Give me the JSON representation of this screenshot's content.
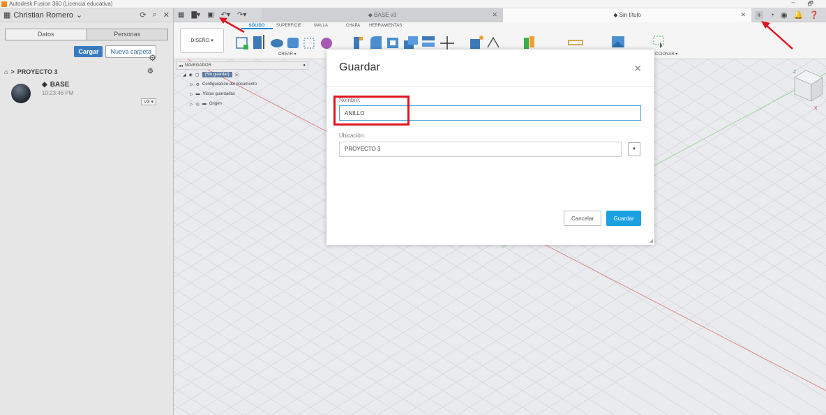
{
  "window": {
    "title": "Autodesk Fusion 360 (Licencia educativa)",
    "min": "–",
    "max": "🗗"
  },
  "data_panel": {
    "user": "Christian Romero",
    "tabs": [
      "Datos",
      "Personas"
    ],
    "upload_label": "Cargar",
    "new_folder_label": "Nueva carpeta",
    "project": "PROYECTO 3",
    "file": {
      "name": "BASE",
      "time": "10:23:46 PM",
      "version": "V3 ▾"
    }
  },
  "tabs": {
    "inactive": "BASE v3",
    "active": "Sin título"
  },
  "toolbar": {
    "design_label": "DISEÑO ▾",
    "workspace_tabs": [
      "SÓLIDO",
      "SUPERFICIE",
      "MALLA",
      "CHAPA",
      "HERRAMIENTAS"
    ],
    "create_label": "CREAR ▾",
    "select_label": "ECCIONAR ▾"
  },
  "navigator": {
    "title": "NAVEGADOR",
    "root": "(Sin guardar)",
    "items": [
      "Configuración del documento",
      "Vistas guardadas",
      "Origen"
    ]
  },
  "dialog": {
    "title": "Guardar",
    "name_label": "Nombre:",
    "name_value": "ANILLO",
    "location_label": "Ubicación:",
    "location_value": "PROYECTO 3",
    "cancel_label": "Cancelar",
    "save_label": "Guardar"
  },
  "colors": {
    "accent": "#1ba1e2",
    "annotation": "#e0141e"
  }
}
